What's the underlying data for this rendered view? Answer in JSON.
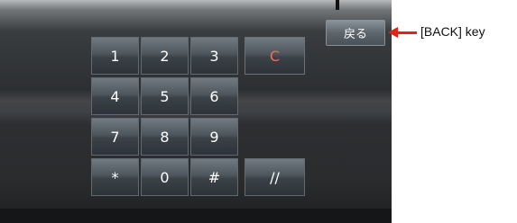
{
  "keypad": {
    "rows": [
      [
        "1",
        "2",
        "3",
        "C"
      ],
      [
        "4",
        "5",
        "6"
      ],
      [
        "7",
        "8",
        "9"
      ],
      [
        "*",
        "0",
        "#",
        "//"
      ]
    ]
  },
  "back_button": {
    "label": "戻る"
  },
  "callout": {
    "text": "[BACK] key",
    "color": "#e2231a"
  }
}
